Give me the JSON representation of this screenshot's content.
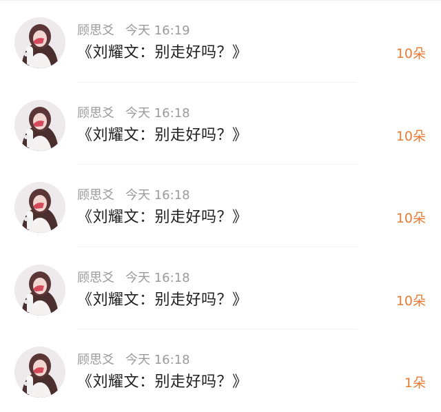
{
  "gift_records": [
    {
      "sender": "顾思爻",
      "time": "今天 16:19",
      "message": "《刘耀文：别走好吗？》",
      "count": "10朵"
    },
    {
      "sender": "顾思爻",
      "time": "今天 16:18",
      "message": "《刘耀文：别走好吗？》",
      "count": "10朵"
    },
    {
      "sender": "顾思爻",
      "time": "今天 16:18",
      "message": "《刘耀文：别走好吗？》",
      "count": "10朵"
    },
    {
      "sender": "顾思爻",
      "time": "今天 16:18",
      "message": "《刘耀文：别走好吗？》",
      "count": "10朵"
    },
    {
      "sender": "顾思爻",
      "time": "今天 16:18",
      "message": "《刘耀文：别走好吗？》",
      "count": "1朵"
    }
  ],
  "colors": {
    "count": "#e87b35",
    "meta": "#9a9a9a",
    "text": "#1f1f1f",
    "divider": "#f3f3f3"
  }
}
